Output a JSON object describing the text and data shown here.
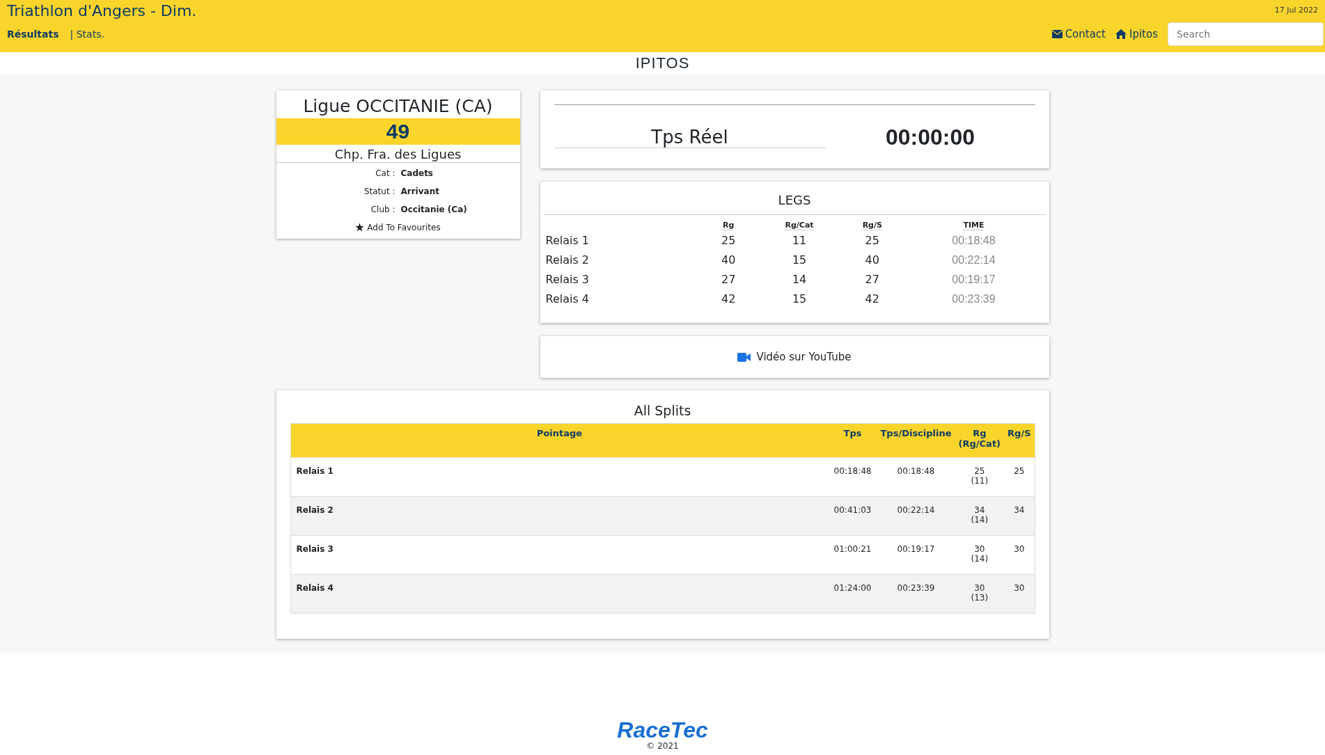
{
  "header": {
    "title": "Triathlon d'Angers - Dim.",
    "date": "17 Jul 2022",
    "nav": [
      {
        "label": "Résultats",
        "selected": true
      },
      {
        "label": "| Stats.",
        "selected": false
      }
    ],
    "links": [
      {
        "label": "Contact",
        "kind": "mail"
      },
      {
        "label": "Ipitos",
        "kind": "home"
      }
    ],
    "search": {
      "placeholder": "Search"
    }
  },
  "brand": "IPITOS",
  "team": {
    "name": "Ligue OCCITANIE (CA)",
    "bib": "49",
    "event": "Chp. Fra. des Ligues",
    "fields": [
      {
        "label": "Cat :",
        "value": "Cadets"
      },
      {
        "label": "Statut :",
        "value": "Arrivant"
      },
      {
        "label": "Club :",
        "value": "Occitanie (Ca)"
      }
    ],
    "favourite": "Add To Favourites"
  },
  "time_card": {
    "label": "Tps Réel",
    "value": "00:00:00"
  },
  "legs": {
    "title": "LEGS",
    "columns": [
      "Rg",
      "Rg/Cat",
      "Rg/S",
      "TIME"
    ],
    "rows": [
      {
        "name": "Relais 1",
        "cells": [
          "25",
          "11",
          "25",
          "00:18:48"
        ]
      },
      {
        "name": "Relais 2",
        "cells": [
          "40",
          "15",
          "40",
          "00:22:14"
        ]
      },
      {
        "name": "Relais 3",
        "cells": [
          "27",
          "14",
          "27",
          "00:19:17"
        ]
      },
      {
        "name": "Relais 4",
        "cells": [
          "42",
          "15",
          "42",
          "00:23:39"
        ]
      }
    ]
  },
  "video": "Vidéo sur YouTube",
  "splits": {
    "title": "All Splits",
    "columns": [
      "Pointage",
      "Tps",
      "Tps/Discipline",
      "Rg (Rg/Cat)",
      "Rg/S"
    ],
    "rows": [
      {
        "name": "Relais 1",
        "tps": "00:18:48",
        "discipline": "00:18:48",
        "rg": "25",
        "rg_cat": "(11)",
        "rg_s": "25"
      },
      {
        "name": "Relais 2",
        "tps": "00:41:03",
        "discipline": "00:22:14",
        "rg": "34",
        "rg_cat": "(14)",
        "rg_s": "34"
      },
      {
        "name": "Relais 3",
        "tps": "01:00:21",
        "discipline": "00:19:17",
        "rg": "30",
        "rg_cat": "(14)",
        "rg_s": "30"
      },
      {
        "name": "Relais 4",
        "tps": "01:24:00",
        "discipline": "00:23:39",
        "rg": "30",
        "rg_cat": "(13)",
        "rg_s": "30"
      }
    ]
  },
  "footer": {
    "logo": "RaceTec",
    "copyright": "© 2021"
  }
}
